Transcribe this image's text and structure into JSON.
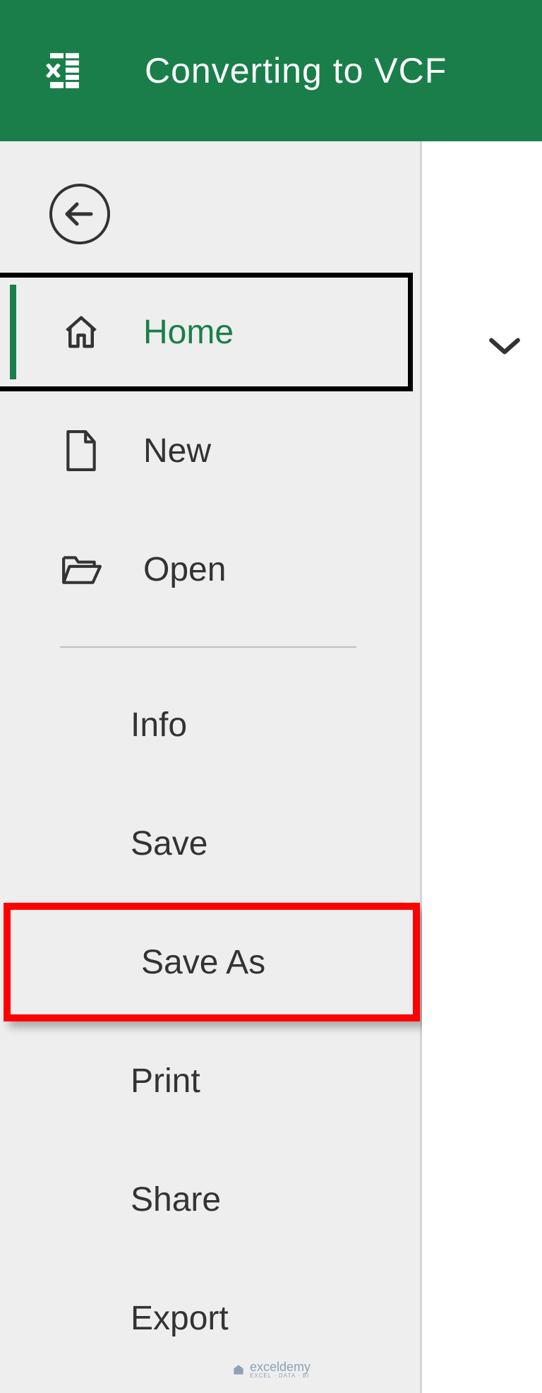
{
  "titlebar": {
    "title": "Converting to VCF"
  },
  "sidebar": {
    "items": [
      {
        "label": "Home"
      },
      {
        "label": "New"
      },
      {
        "label": "Open"
      },
      {
        "label": "Info"
      },
      {
        "label": "Save"
      },
      {
        "label": "Save As"
      },
      {
        "label": "Print"
      },
      {
        "label": "Share"
      },
      {
        "label": "Export"
      }
    ]
  },
  "watermark": {
    "brand": "exceldemy",
    "tagline": "EXCEL · DATA · BI"
  }
}
